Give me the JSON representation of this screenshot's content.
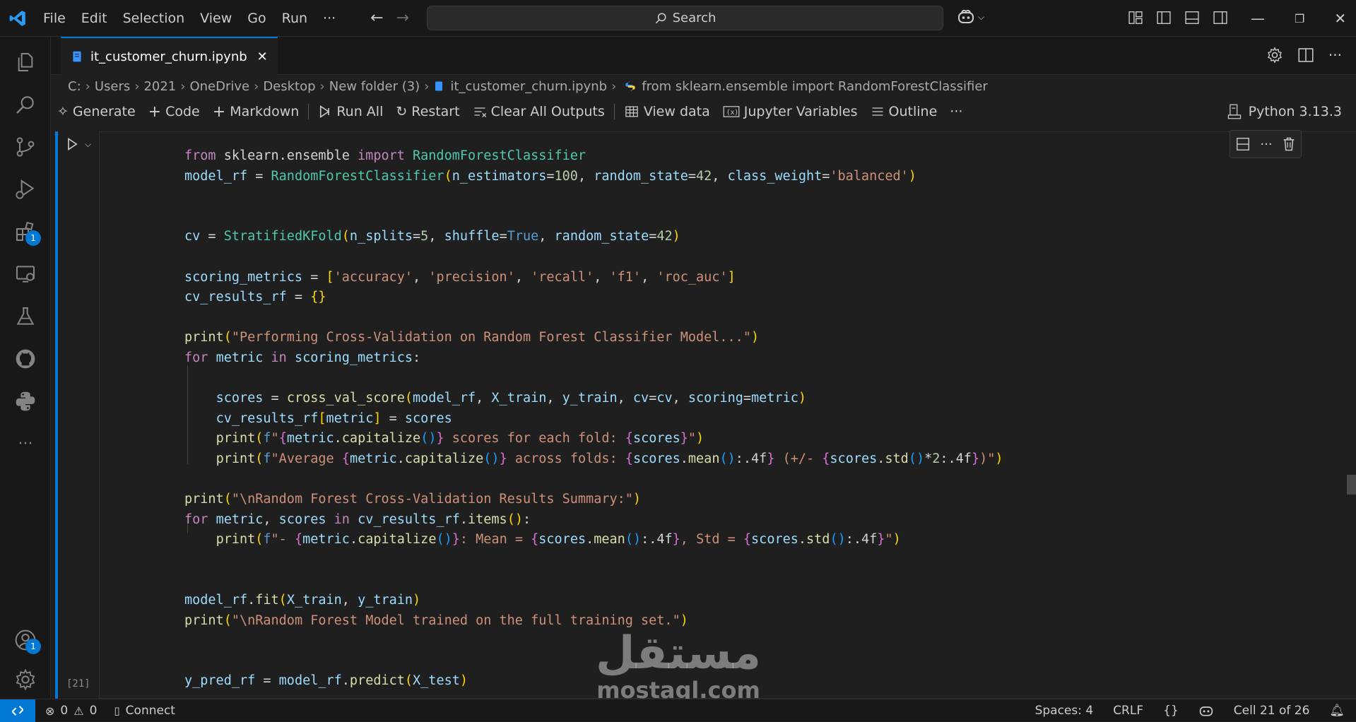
{
  "titlebar": {
    "menu": [
      "File",
      "Edit",
      "Selection",
      "View",
      "Go",
      "Run",
      "···"
    ],
    "search_label": "Search"
  },
  "activitybar": {
    "extensions_badge": "1",
    "accounts_badge": "1"
  },
  "tab": {
    "filename": "it_customer_churn.ipynb"
  },
  "breadcrumb": [
    "C:",
    "Users",
    "2021",
    "OneDrive",
    "Desktop",
    "New folder (3)",
    "it_customer_churn.ipynb",
    "from sklearn.ensemble import RandomForestClassifier"
  ],
  "toolbar": {
    "generate": "Generate",
    "code": "Code",
    "markdown": "Markdown",
    "run_all": "Run All",
    "restart": "Restart",
    "clear_outputs": "Clear All Outputs",
    "view_data": "View data",
    "jupyter_variables": "Jupyter Variables",
    "outline": "Outline",
    "more": "···",
    "kernel": "Python 3.13.3"
  },
  "cell": {
    "exec_count": "[21]"
  },
  "watermark": {
    "arabic": "مستقل",
    "latin": "mostaql.com"
  },
  "statusbar": {
    "errors": "0",
    "warnings": "0",
    "connect": "Connect",
    "spaces": "Spaces: 4",
    "eol": "CRLF",
    "braces": "{}",
    "cell_pos": "Cell 21 of 26"
  },
  "colors": {
    "accent": "#0078d4",
    "background": "#1f1f1f",
    "chrome": "#181818"
  }
}
